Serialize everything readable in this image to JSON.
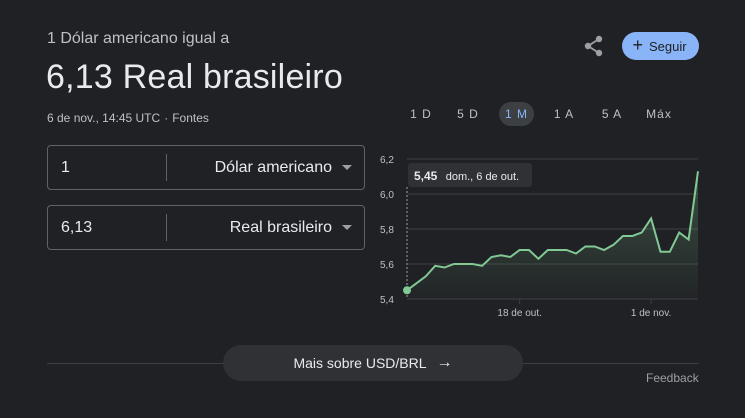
{
  "header": {
    "subtitle": "1 Dólar americano igual a",
    "main_value": "6,13 Real brasileiro",
    "timestamp": "6 de nov., 14:45 UTC",
    "separator": "·",
    "sources_label": "Fontes",
    "share_icon": "share-icon",
    "follow_label": "Seguir",
    "follow_icon": "+"
  },
  "converter": {
    "from": {
      "amount": "1",
      "currency": "Dólar americano"
    },
    "to": {
      "amount": "6,13",
      "currency": "Real brasileiro"
    }
  },
  "ranges": [
    {
      "label": "1 D",
      "active": false
    },
    {
      "label": "5 D",
      "active": false
    },
    {
      "label": "1 M",
      "active": true
    },
    {
      "label": "1 A",
      "active": false
    },
    {
      "label": "5 A",
      "active": false
    },
    {
      "label": "Máx",
      "active": false
    }
  ],
  "tooltip": {
    "value": "5,45",
    "date": "dom., 6 de out."
  },
  "chart_data": {
    "type": "area",
    "y_ticks": [
      "6,2",
      "6,0",
      "5,8",
      "5,6",
      "5,4"
    ],
    "x_ticks": [
      "18 de out.",
      "1 de nov."
    ],
    "ylim": [
      5.4,
      6.2
    ],
    "values": [
      5.45,
      5.49,
      5.53,
      5.59,
      5.58,
      5.6,
      5.6,
      5.6,
      5.59,
      5.64,
      5.65,
      5.64,
      5.68,
      5.68,
      5.63,
      5.68,
      5.68,
      5.68,
      5.66,
      5.7,
      5.7,
      5.68,
      5.71,
      5.76,
      5.76,
      5.78,
      5.86,
      5.67,
      5.67,
      5.78,
      5.74,
      6.13
    ],
    "colors": {
      "line": "#81c995",
      "grid": "#3c4043",
      "text": "#bdc1c6"
    }
  },
  "footer": {
    "more_label": "Mais sobre USD/BRL",
    "arrow_icon": "→",
    "feedback_label": "Feedback"
  }
}
